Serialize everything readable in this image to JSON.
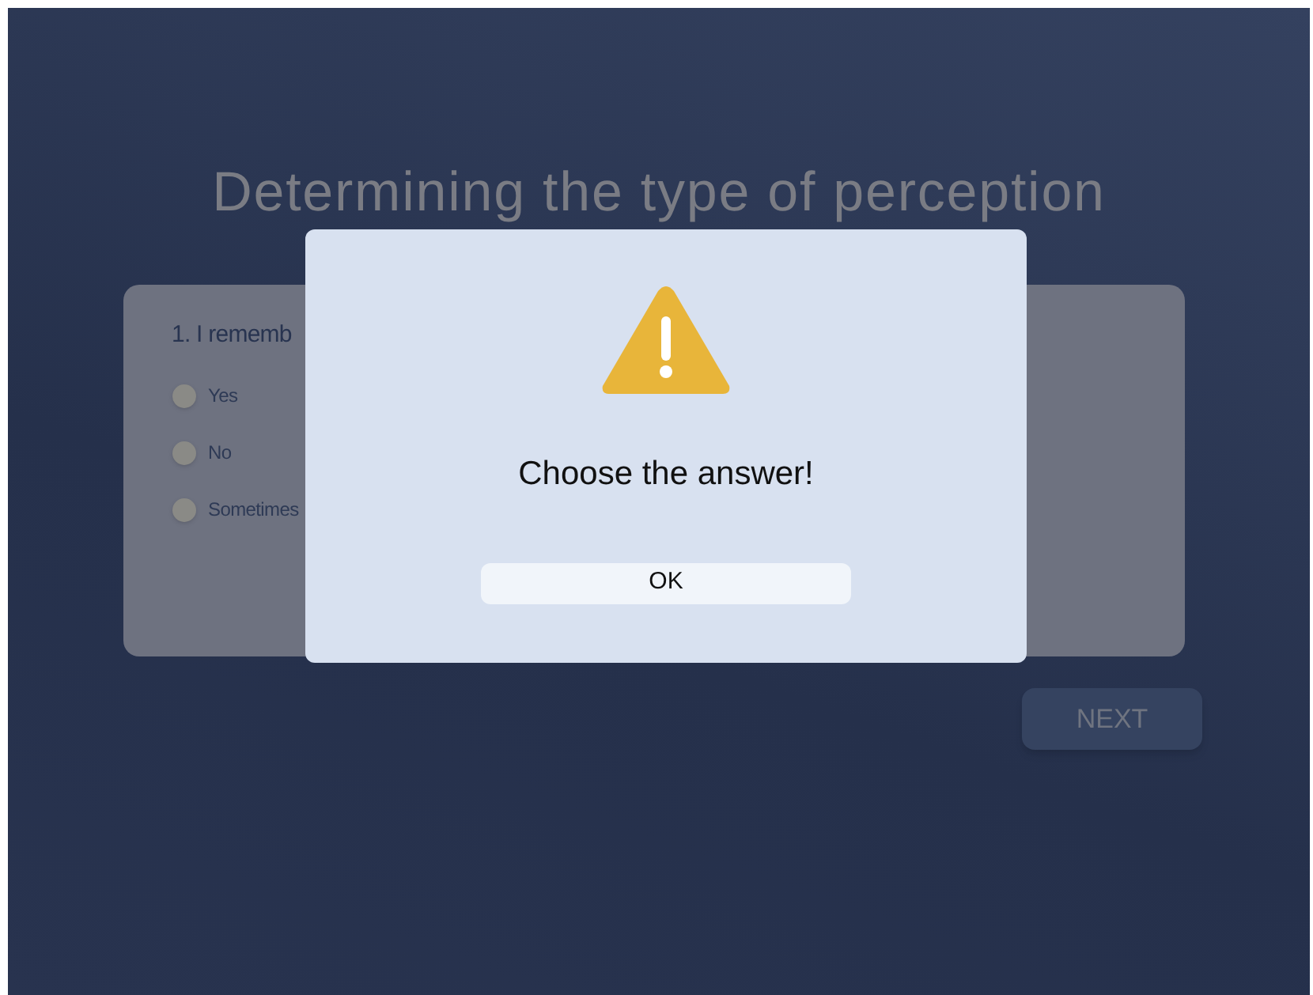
{
  "title": "Determining the type of perception",
  "question": {
    "text": "1. I rememb",
    "options": [
      {
        "label": "Yes",
        "selected": false
      },
      {
        "label": "No",
        "selected": false
      },
      {
        "label": "Sometimes",
        "selected": false
      }
    ]
  },
  "next_button": "NEXT",
  "dialog": {
    "message": "Choose the answer!",
    "button": "OK"
  }
}
